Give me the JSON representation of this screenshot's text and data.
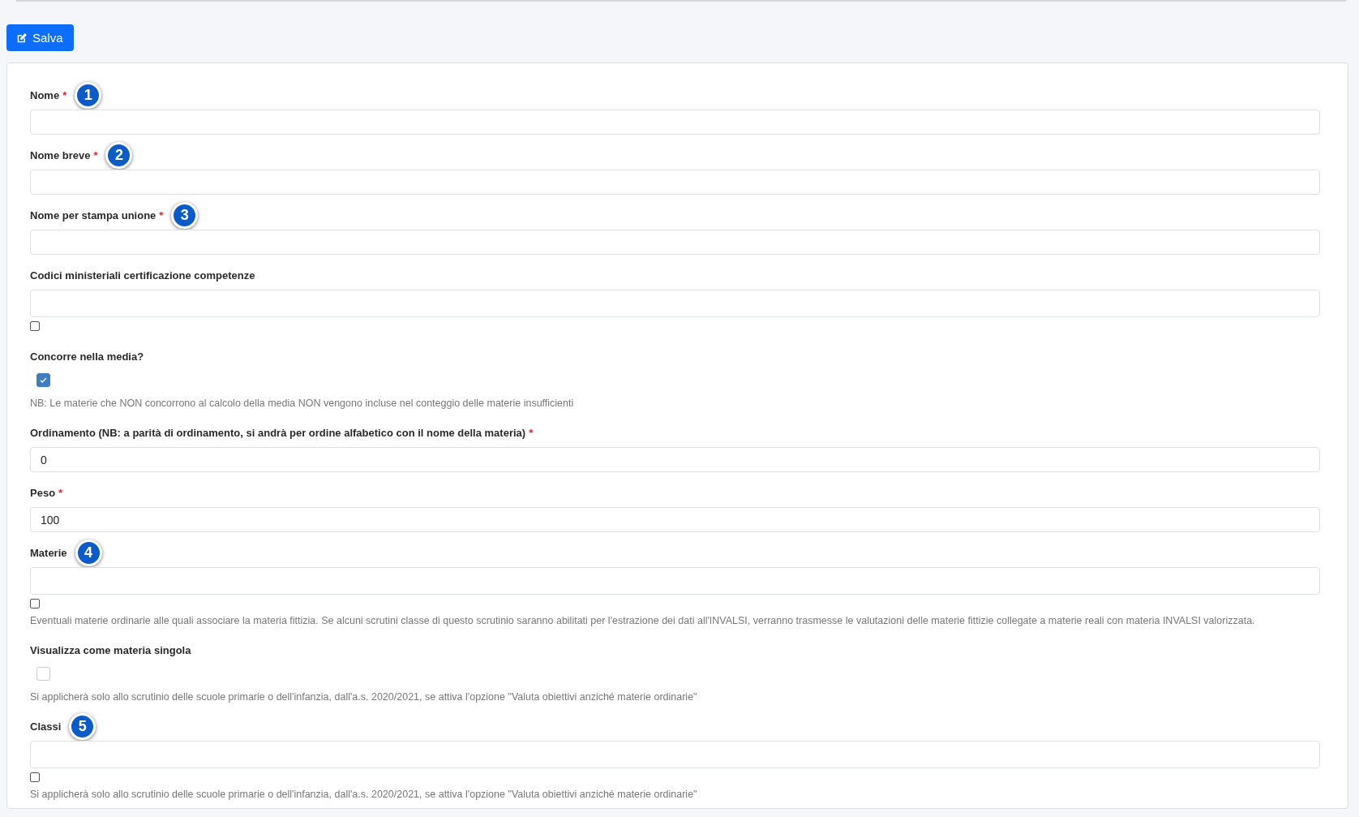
{
  "toolbar": {
    "save_button": "Salva"
  },
  "fields": [
    {
      "kind": "text",
      "label": "Nome",
      "required": "*",
      "badge": "1"
    },
    {
      "kind": "text",
      "label": "Nome breve",
      "required": "*",
      "badge": "2"
    },
    {
      "kind": "text",
      "label": "Nome per stampa unione",
      "required": "*",
      "badge": "3"
    },
    {
      "kind": "multi",
      "label": "Codici ministeriali certificazione competenze",
      "checkbox": {
        "checked": false
      }
    },
    {
      "kind": "checkbox",
      "label": "Concorre nella media?",
      "checked": true,
      "help": "NB: Le materie che NON concorrono al calcolo della media NON vengono incluse nel conteggio delle materie insufficienti"
    },
    {
      "kind": "text",
      "label": "Ordinamento (NB: a parità di ordinamento, si andrà per ordine alfabetico con il nome della materia)",
      "required": "*",
      "value": "0"
    },
    {
      "kind": "text",
      "label": "Peso",
      "required": "*",
      "value": "100"
    },
    {
      "kind": "multi",
      "label": "Materie",
      "badge": "4",
      "checkbox": {
        "checked": false
      },
      "help": "Eventuali materie ordinarie alle quali associare la materia fittizia. Se alcuni scrutini classe di questo scrutinio saranno abilitati per l'estrazione dei dati all'INVALSI, verranno trasmesse le valutazioni delle materie fittizie collegate a materie reali con materia INVALSI valorizzata."
    },
    {
      "kind": "checkbox",
      "label": "Visualizza come materia singola",
      "checked": false,
      "help": "Si applicherà solo allo scrutinio delle scuole primarie o dell'infanzia, dall'a.s. 2020/2021, se attiva l'opzione \"Valuta obiettivi anziché materie ordinarie\""
    },
    {
      "kind": "multi",
      "label": "Classi",
      "badge": "5",
      "checkbox": {
        "checked": false
      },
      "help": "Si applicherà solo allo scrutinio delle scuole primarie o dell'infanzia, dall'a.s. 2020/2021, se attiva l'opzione \"Valuta obiettivi anziché materie ordinarie\""
    }
  ]
}
